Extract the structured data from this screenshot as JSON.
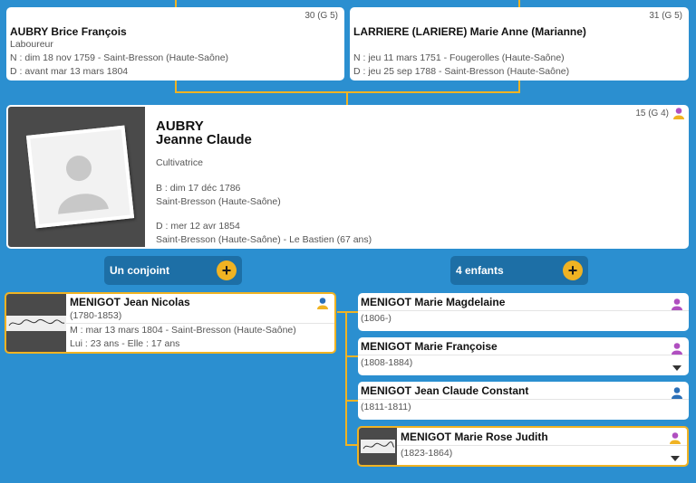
{
  "father": {
    "gen": "30 (G 5)",
    "name": "AUBRY Brice François",
    "occupation": "Laboureur",
    "birth": "N : dim 18 nov 1759 - Saint-Bresson (Haute-Saône)",
    "death": "D : avant mar 13 mars 1804"
  },
  "mother": {
    "gen": "31 (G 5)",
    "name": "LARRIERE (LARIERE) Marie Anne (Marianne)",
    "birth": "N : jeu 11 mars 1751 - Fougerolles (Haute-Saône)",
    "death": "D : jeu 25 sep 1788 - Saint-Bresson (Haute-Saône)"
  },
  "main": {
    "gen": "15 (G 4)",
    "surname": "AUBRY",
    "given": "Jeanne Claude",
    "occupation": "Cultivatrice",
    "birth_date": "B : dim 17 déc 1786",
    "birth_place": "Saint-Bresson (Haute-Saône)",
    "death_date": "D : mer 12 avr 1854",
    "death_place": "Saint-Bresson (Haute-Saône) - Le Bastien (67 ans)"
  },
  "spouse_pill": "Un conjoint",
  "children_pill": "4 enfants",
  "spouse": {
    "name": "MENIGOT Jean Nicolas",
    "years": "(1780-1853)",
    "marriage": "M : mar 13 mars 1804 - Saint-Bresson (Haute-Saône)",
    "ages": "Lui : 23 ans - Elle : 17 ans"
  },
  "children": [
    {
      "name": "MENIGOT Marie Magdelaine",
      "years": "(1806-)"
    },
    {
      "name": "MENIGOT Marie Françoise",
      "years": "(1808-1884)"
    },
    {
      "name": "MENIGOT Jean Claude Constant",
      "years": "(1811-1811)"
    },
    {
      "name": "MENIGOT Marie Rose Judith",
      "years": "(1823-1864)"
    }
  ],
  "colors": {
    "female": "#b04fc0",
    "male": "#2a6fb8",
    "highlight": "#f0b323"
  }
}
